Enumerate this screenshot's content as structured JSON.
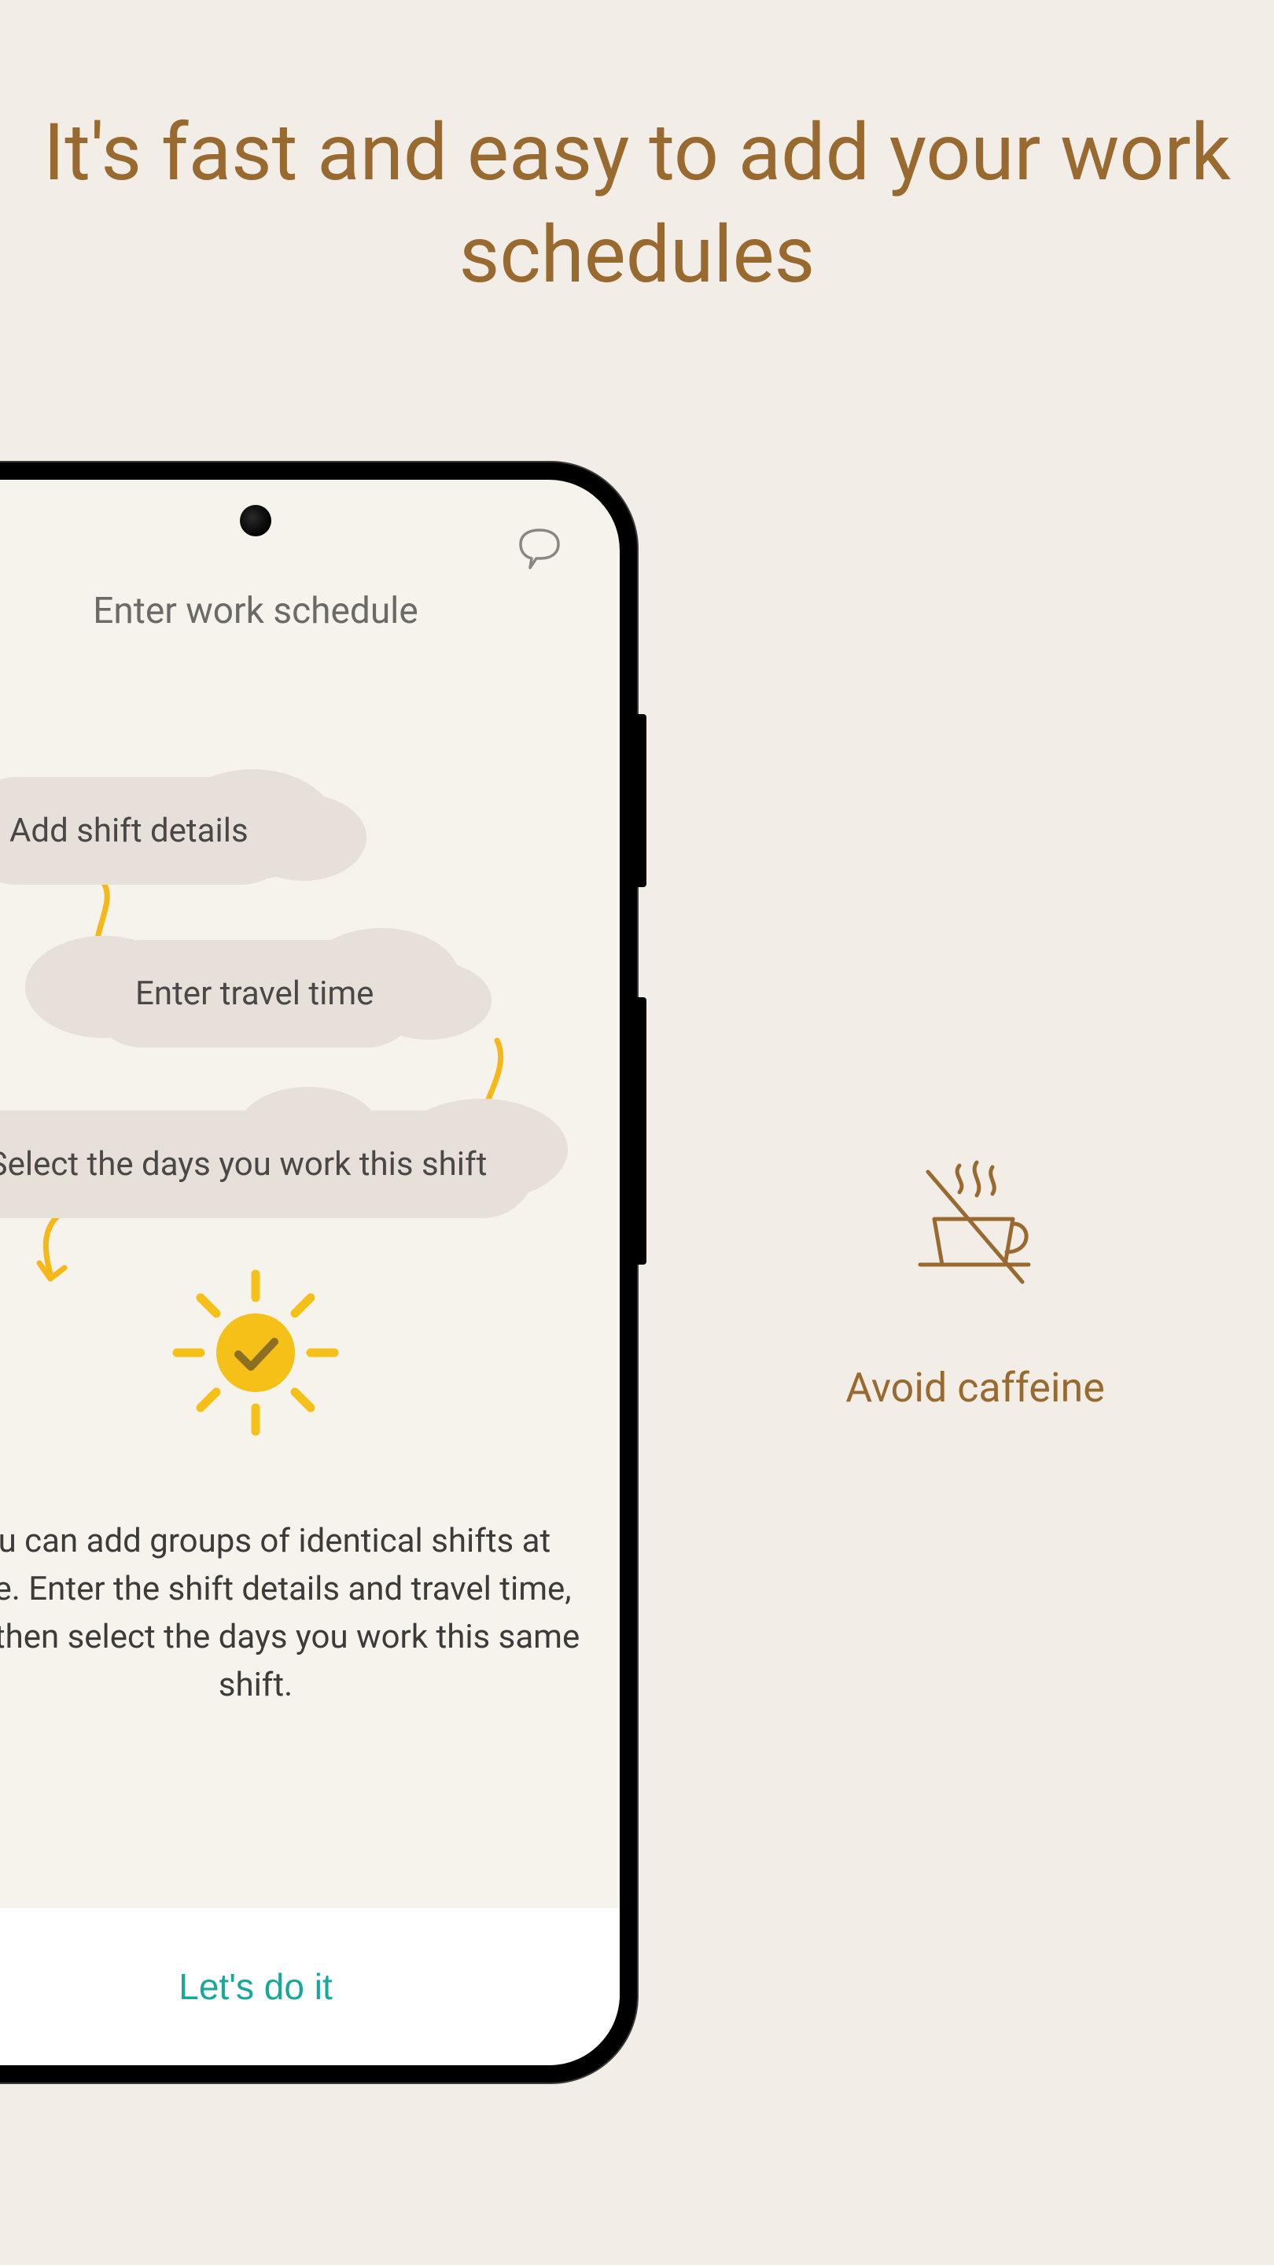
{
  "headline": "It's fast and easy to add your work schedules",
  "phone_screen": {
    "chat_icon": "chat-bubble-icon",
    "title": "Enter work schedule",
    "flow_steps": [
      {
        "label": "Add shift details"
      },
      {
        "label": "Enter travel time"
      },
      {
        "label": "Select the days you work this shift"
      }
    ],
    "success_icon": "sun-check-icon",
    "description": "You can add groups of identical shifts at once. Enter the shift details and travel time, and then select the days you work this same shift.",
    "cta_label": "Let's do it"
  },
  "tip": {
    "icon": "no-caffeine-icon",
    "label": "Avoid caffeine"
  },
  "colors": {
    "bg": "#f2ede7",
    "accent_brown": "#996a2f",
    "accent_teal": "#17a89b",
    "accent_gold": "#f5b817",
    "cloud": "#e6e0d9",
    "text_dark": "#3d3b39",
    "text_muted": "#6c6a67"
  }
}
